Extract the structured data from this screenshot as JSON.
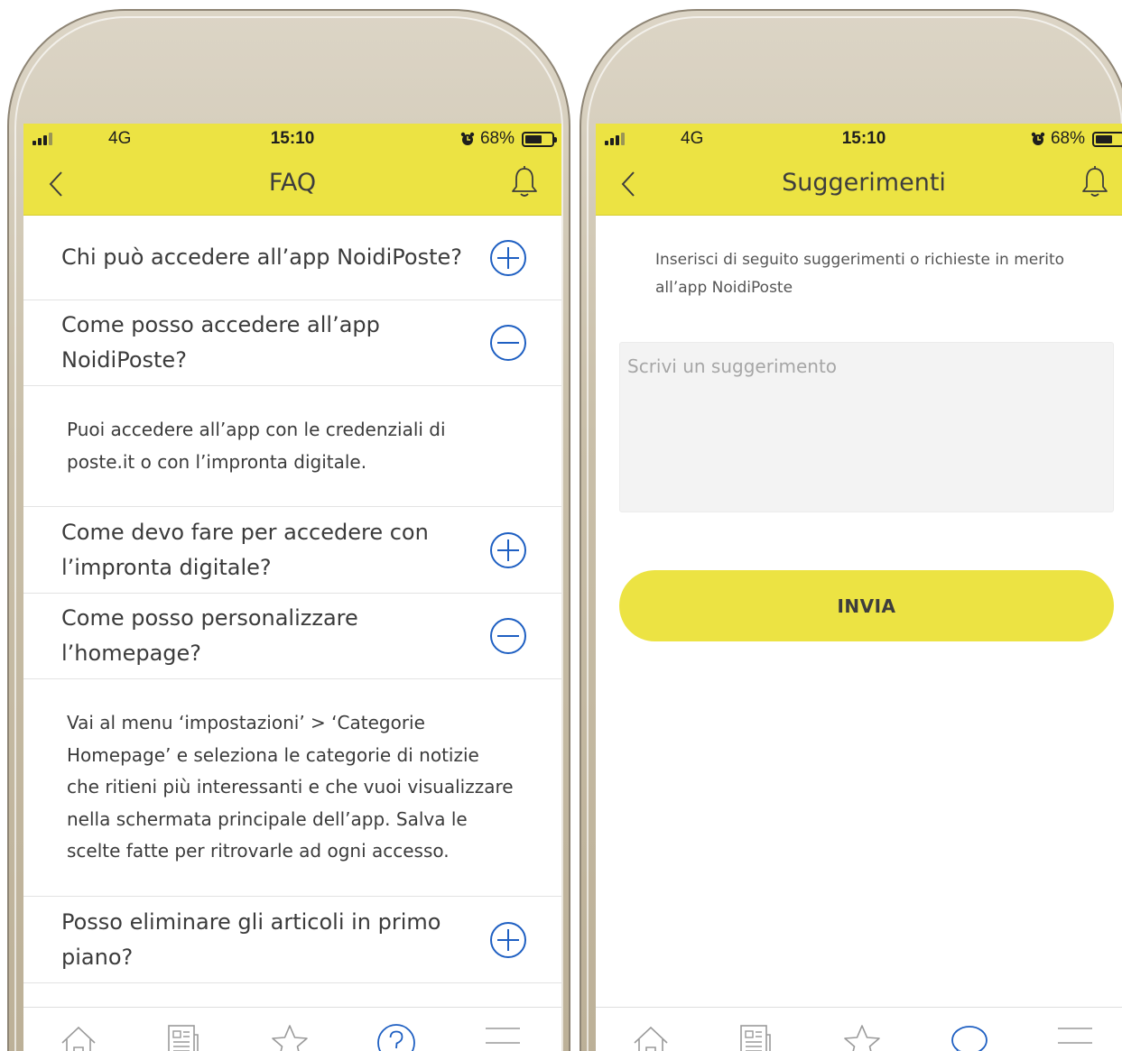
{
  "colors": {
    "accent_yellow": "#ece343",
    "icon_blue": "#1e5fc2",
    "icon_grey": "#9a9a9a",
    "text_dark": "#3b3b3b"
  },
  "left_phone": {
    "status": {
      "network": "4G",
      "time": "15:10",
      "battery": "68%"
    },
    "title": "FAQ",
    "faq": [
      {
        "question": "Chi può accedere all’app NoidiPoste?",
        "state": "collapsed",
        "icon": "plus-circle-icon"
      },
      {
        "question": "Come posso accedere all’app NoidiPoste?",
        "state": "expanded",
        "icon": "minus-circle-icon",
        "answer": "Puoi accedere all’app con le credenziali di poste.it o con l’impronta digitale."
      },
      {
        "question": "Come devo fare per accedere con l’impronta digitale?",
        "state": "collapsed",
        "icon": "plus-circle-icon"
      },
      {
        "question": "Come posso personalizzare l’homepage?",
        "state": "expanded",
        "icon": "minus-circle-icon",
        "answer": "Vai al menu ‘impostazioni’ > ‘Categorie Homepage’ e seleziona le  categorie di notizie che ritieni più interessanti e che vuoi visualizzare nella schermata principale dell’app. Salva le scelte fatte per ritrovarle ad ogni accesso."
      },
      {
        "question": "Posso eliminare gli articoli in primo piano?",
        "state": "collapsed",
        "icon": "plus-circle-icon"
      }
    ],
    "tabs": [
      "home-icon",
      "news-icon",
      "star-icon",
      "help-icon",
      "menu-icon"
    ],
    "active_tab": "help-icon"
  },
  "right_phone": {
    "status": {
      "network": "4G",
      "time": "15:10",
      "battery": "68%"
    },
    "title": "Suggerimenti",
    "intro": "Inserisci di seguito suggerimenti o richieste in merito all’app NoidiPoste",
    "input_placeholder": "Scrivi un suggerimento",
    "input_value": "",
    "send_label": "INVIA",
    "tabs": [
      "home-icon",
      "news-icon",
      "star-icon",
      "chat-icon",
      "menu-icon"
    ],
    "active_tab": "chat-icon"
  },
  "battery_level": 0.68
}
